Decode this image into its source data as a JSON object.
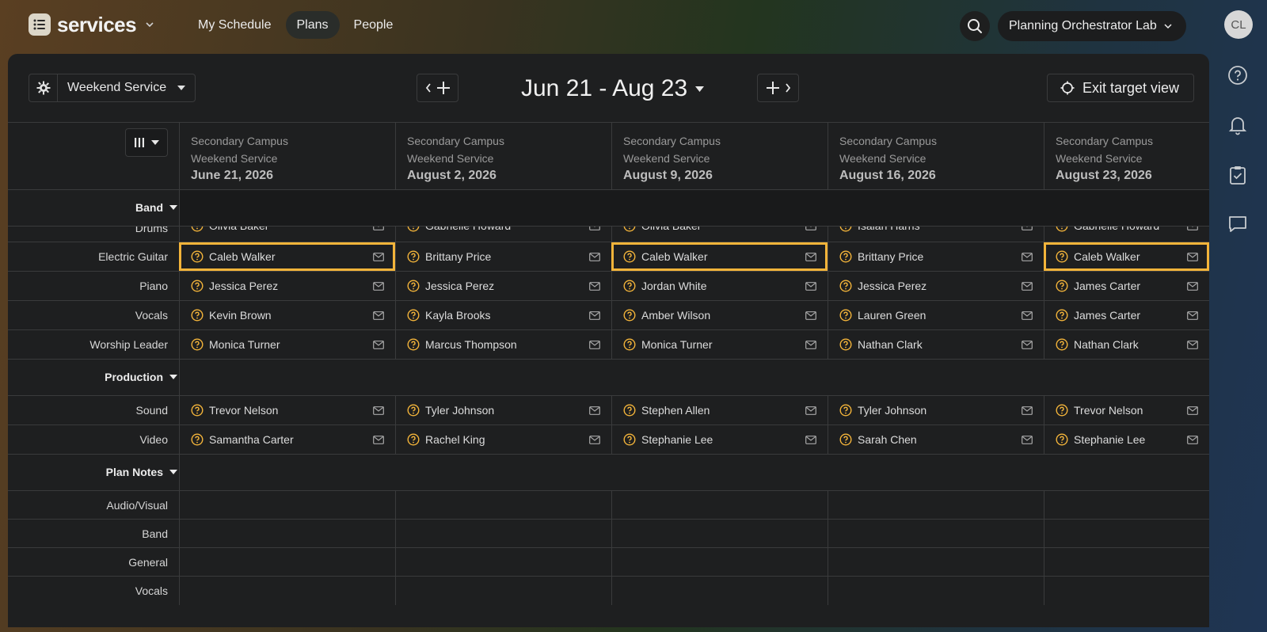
{
  "app": {
    "name": "services"
  },
  "nav": {
    "items": [
      "My Schedule",
      "Plans",
      "People"
    ],
    "active": "Plans"
  },
  "org": {
    "name": "Planning Orchestrator Lab"
  },
  "user": {
    "initials": "CL"
  },
  "toolbar": {
    "service_type": "Weekend Service",
    "date_range": "Jun 21 - Aug 23",
    "exit_label": "Exit target view"
  },
  "columns": [
    {
      "campus": "Secondary Campus",
      "service": "Weekend Service",
      "date": "June 21, 2026"
    },
    {
      "campus": "Secondary Campus",
      "service": "Weekend Service",
      "date": "August 2, 2026"
    },
    {
      "campus": "Secondary Campus",
      "service": "Weekend Service",
      "date": "August 9, 2026"
    },
    {
      "campus": "Secondary Campus",
      "service": "Weekend Service",
      "date": "August 16, 2026"
    },
    {
      "campus": "Secondary Campus",
      "service": "Weekend Service",
      "date": "August 23, 2026"
    }
  ],
  "sections": {
    "band": {
      "label": "Band",
      "positions": [
        {
          "name": "Drums",
          "people": [
            "Olivia Baker",
            "Gabrielle Howard",
            "Olivia Baker",
            "Isaiah Harris",
            "Gabrielle Howard"
          ]
        },
        {
          "name": "Electric Guitar",
          "people": [
            "Caleb Walker",
            "Brittany Price",
            "Caleb Walker",
            "Brittany Price",
            "Caleb Walker"
          ],
          "selected": [
            true,
            false,
            true,
            false,
            true
          ]
        },
        {
          "name": "Piano",
          "people": [
            "Jessica Perez",
            "Jessica Perez",
            "Jordan White",
            "Jessica Perez",
            "James Carter"
          ]
        },
        {
          "name": "Vocals",
          "people": [
            "Kevin Brown",
            "Kayla Brooks",
            "Amber Wilson",
            "Lauren Green",
            "James Carter"
          ]
        },
        {
          "name": "Worship Leader",
          "people": [
            "Monica Turner",
            "Marcus Thompson",
            "Monica Turner",
            "Nathan Clark",
            "Nathan Clark"
          ]
        }
      ]
    },
    "production": {
      "label": "Production",
      "positions": [
        {
          "name": "Sound",
          "people": [
            "Trevor Nelson",
            "Tyler Johnson",
            "Stephen Allen",
            "Tyler Johnson",
            "Trevor Nelson"
          ]
        },
        {
          "name": "Video",
          "people": [
            "Samantha Carter",
            "Rachel King",
            "Stephanie Lee",
            "Sarah Chen",
            "Stephanie Lee"
          ]
        }
      ]
    },
    "notes": {
      "label": "Plan Notes",
      "categories": [
        "Audio/Visual",
        "Band",
        "General",
        "Vocals"
      ]
    }
  },
  "colors": {
    "accent": "#f3b43a",
    "panel": "#1e1f20",
    "border": "#3a3b3c"
  },
  "icons": {
    "status": "question-circle-icon",
    "contact": "mail-icon",
    "settings": "gear-icon",
    "target": "crosshair-icon"
  }
}
